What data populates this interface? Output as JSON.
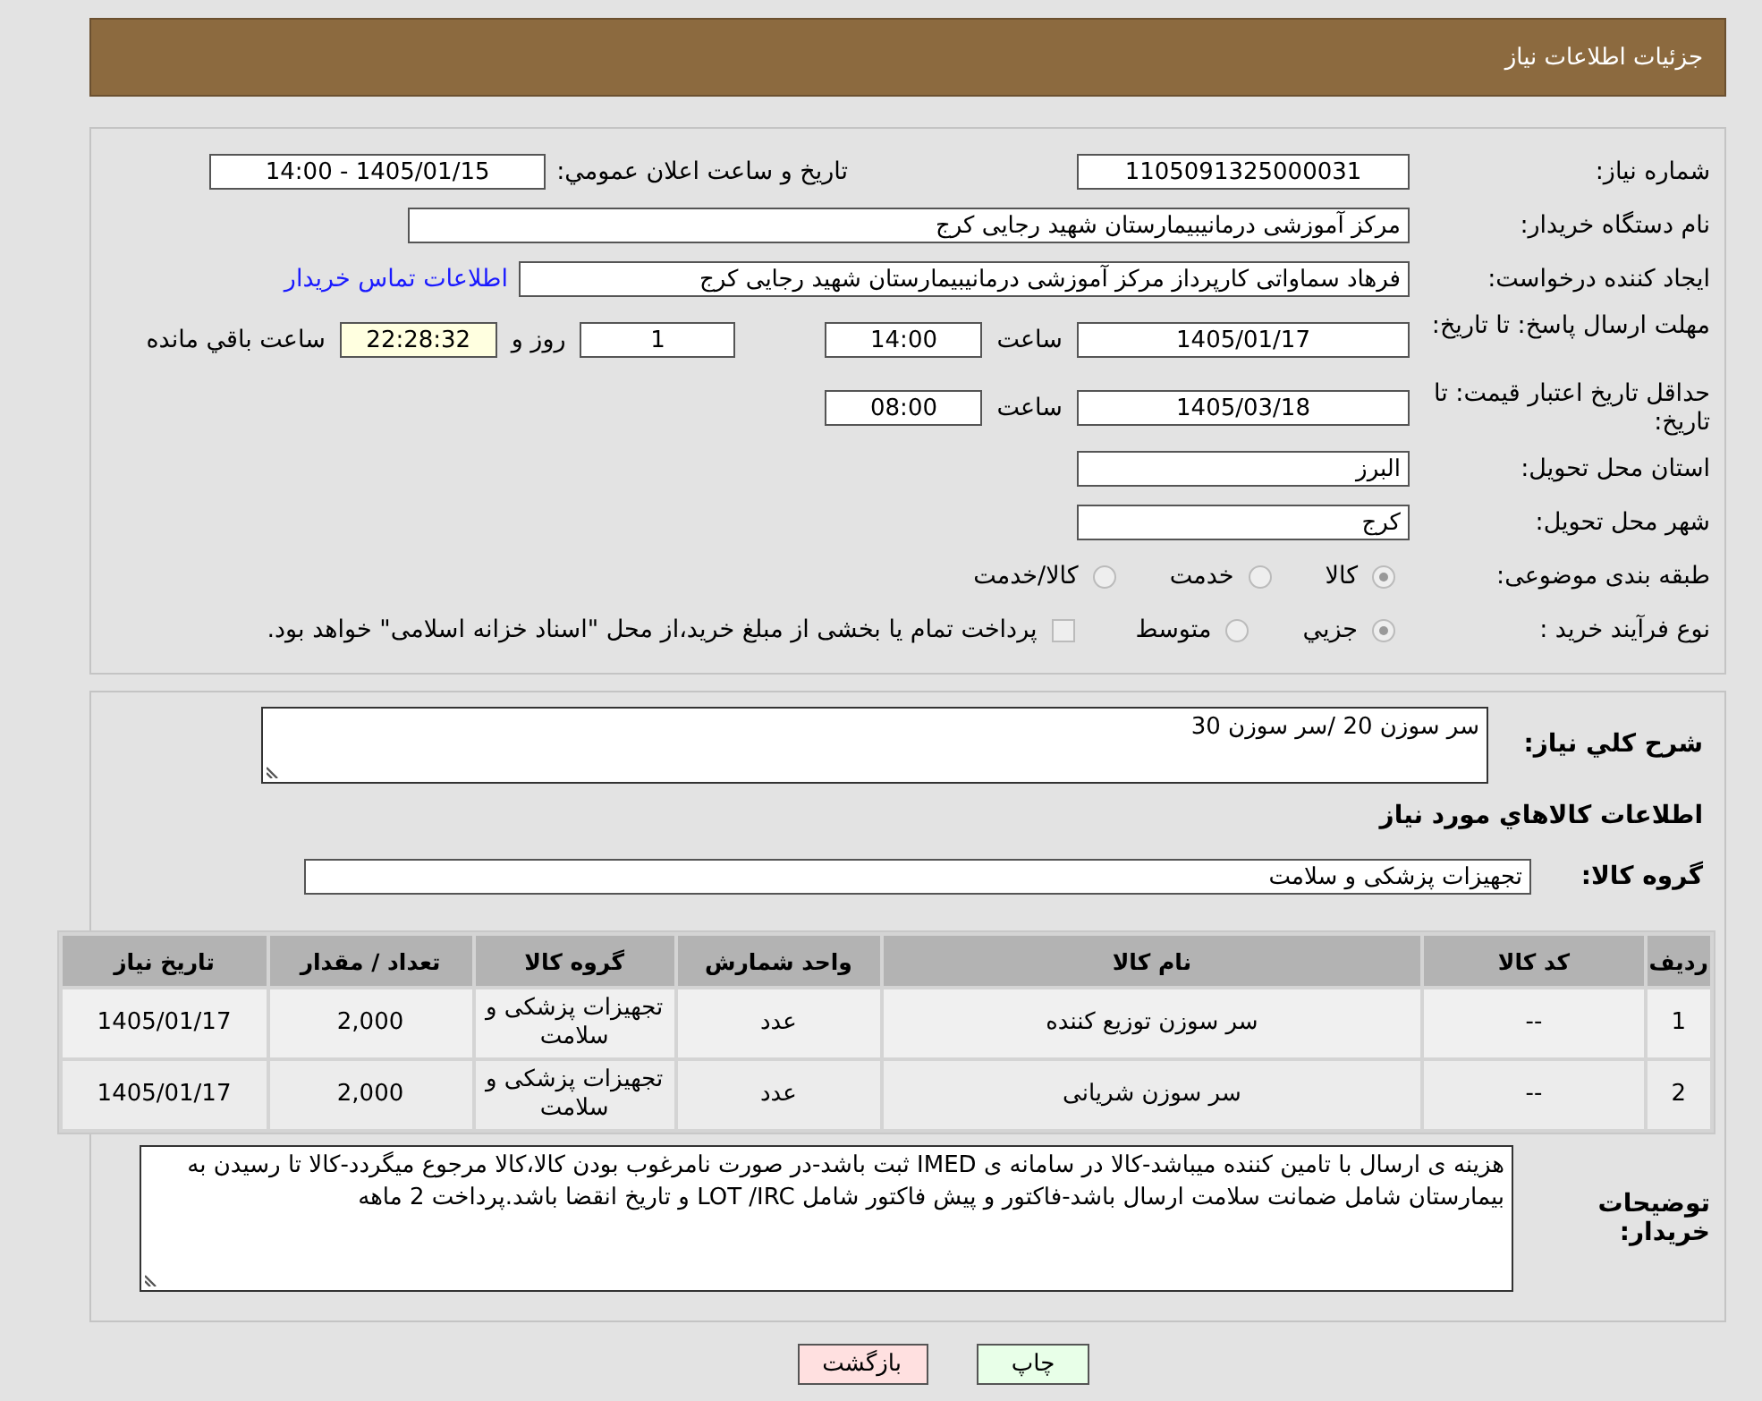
{
  "header": {
    "title": "جزئیات اطلاعات نیاز"
  },
  "details": {
    "need_number": {
      "label": "شماره نیاز:",
      "value": "1105091325000031"
    },
    "announce": {
      "label": "تاريخ و ساعت اعلان عمومي:",
      "value": "1405/01/15 - 14:00"
    },
    "buyer": {
      "label": "نام دستگاه خریدار:",
      "value": "مرکز آموزشی درمانیبیمارستان شهید رجایی کرج"
    },
    "creator": {
      "label": "ایجاد کننده درخواست:",
      "value": "فرهاد سماواتی کارپرداز مرکز آموزشی درمانیبیمارستان شهید رجایی کرج",
      "link": "اطلاعات تماس خریدار"
    },
    "deadline": {
      "label": "مهلت ارسال پاسخ: تا تاریخ:",
      "date": "1405/01/17",
      "time_label": "ساعت",
      "time": "14:00",
      "days": "1",
      "days_label": "روز و",
      "remaining": "22:28:32",
      "remaining_label": "ساعت باقي مانده"
    },
    "validity": {
      "label": "حداقل تاریخ اعتبار قیمت: تا تاریخ:",
      "date": "1405/03/18",
      "time_label": "ساعت",
      "time": "08:00"
    },
    "province": {
      "label": "استان محل تحویل:",
      "value": "البرز"
    },
    "city": {
      "label": "شهر محل تحویل:",
      "value": "کرج"
    },
    "category": {
      "label": "طبقه بندی موضوعی:",
      "options": [
        {
          "label": "کالا",
          "selected": true
        },
        {
          "label": "خدمت",
          "selected": false
        },
        {
          "label": "کالا/خدمت",
          "selected": false
        }
      ]
    },
    "process": {
      "label": "نوع فرآیند خرید :",
      "options": [
        {
          "label": "جزيي",
          "selected": true
        },
        {
          "label": "متوسط",
          "selected": false
        }
      ],
      "treasury": {
        "label": "پرداخت تمام یا بخشی از مبلغ خرید،از محل \"اسناد خزانه اسلامی\" خواهد بود.",
        "checked": false
      }
    }
  },
  "goods": {
    "description": {
      "label": "شرح كلي نياز:",
      "value": "سر سوزن 20 /سر سوزن 30"
    },
    "heading": "اطلاعات كالاهاي مورد نياز",
    "group": {
      "label": "گروه کالا:",
      "value": "تجهیزات پزشکی و سلامت"
    },
    "table": {
      "columns": [
        "رديف",
        "کد کالا",
        "نام کالا",
        "واحد شمارش",
        "گروه کالا",
        "تعداد / مقدار",
        "تاریخ نیاز"
      ],
      "rows": [
        [
          "1",
          "--",
          "سر سوزن توزیع کننده",
          "عدد",
          "تجهیزات پزشکی و سلامت",
          "2,000",
          "1405/01/17"
        ],
        [
          "2",
          "--",
          "سر سوزن شریانی",
          "عدد",
          "تجهیزات پزشکی و سلامت",
          "2,000",
          "1405/01/17"
        ]
      ]
    },
    "notes": {
      "label": "توضیحات خریدار:",
      "value": "هزینه ی ارسال با تامین کننده میباشد-کالا در سامانه ی IMED ثبت باشد-در صورت نامرغوب بودن کالا،کالا مرجوع میگردد-کالا تا رسیدن به بیمارستان شامل ضمانت سلامت ارسال باشد-فاکتور و پیش فاکتور شامل LOT /IRC و تاریخ انقضا باشد.پرداخت 2 ماهه"
    }
  },
  "buttons": {
    "print": "چاپ",
    "back": "بازگشت"
  }
}
